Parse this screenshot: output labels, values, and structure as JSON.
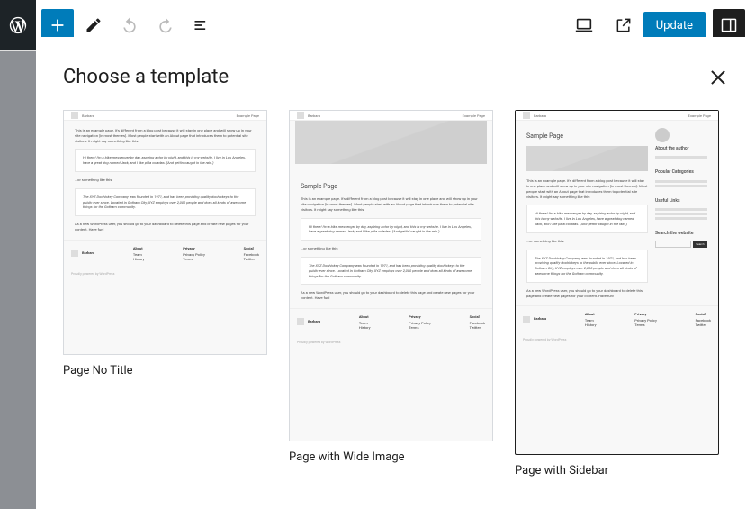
{
  "toolbar": {
    "update_label": "Update"
  },
  "modal": {
    "title": "Choose a template",
    "templates": [
      {
        "label": "Page No Title"
      },
      {
        "label": "Page with Wide Image"
      },
      {
        "label": "Page with Sidebar"
      }
    ],
    "selected_index": 2
  },
  "preview": {
    "brand": "Barbara",
    "top_right": "Example Page",
    "sample_page_heading": "Sample Page",
    "intro": "This is an example page. It's different from a blog post because it will stay in one place and will show up in your site navigation (in most themes). Most people start with an About page that introduces them to potential site visitors. It might say something like this:",
    "quote1": "Hi there! I'm a bike messenger by day, aspiring actor by night, and this is my website. I live in Los Angeles, have a great dog named Jack, and I like piña coladas. (And gettin' caught in the rain.)",
    "or_line": "...or something like this:",
    "quote2": "The XYZ Doohickey Company was founded in 1971, and has been providing quality doohickeys to the public ever since. Located in Gotham City, XYZ employs over 2,000 people and does all kinds of awesome things for the Gotham community.",
    "outro": "As a new WordPress user, you should go to your dashboard to delete this page and create new pages for your content. Have fun!",
    "footer": {
      "brand": "Barbara",
      "cols": [
        {
          "h": "About",
          "l1": "Team",
          "l2": "History"
        },
        {
          "h": "Privacy",
          "l1": "Privacy Policy",
          "l2": "Terms"
        },
        {
          "h": "Social",
          "l1": "Facebook",
          "l2": "Twitter"
        }
      ],
      "copyright": "Proudly powered by WordPress"
    },
    "sidebar": {
      "about_h": "About the author",
      "cats_h": "Popular Categories",
      "links_h": "Useful Links",
      "search_h": "Search the website",
      "search_btn": "Search"
    }
  }
}
